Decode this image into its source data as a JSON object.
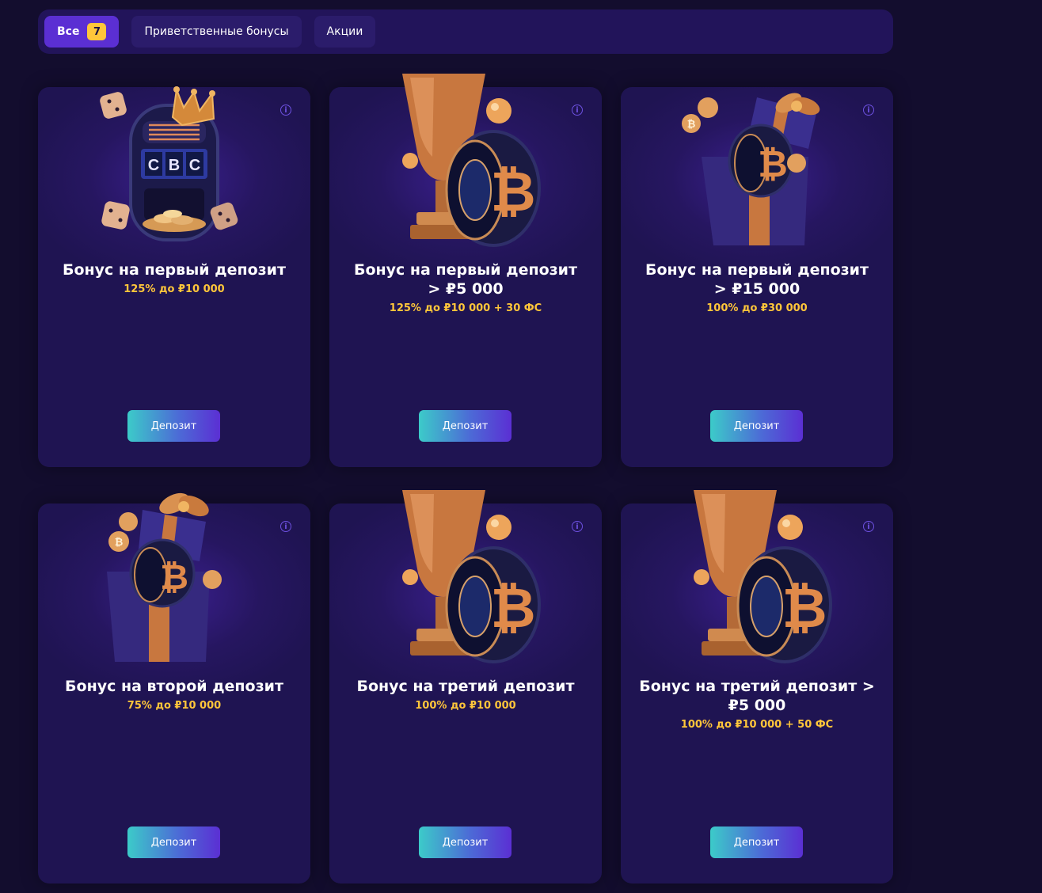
{
  "filters": {
    "all_label": "Все",
    "all_count": "7",
    "welcome_label": "Приветственные бонусы",
    "promo_label": "Акции"
  },
  "cards": [
    {
      "title": "Бонус на первый депозит",
      "subtitle": "125% до ₽10 000",
      "button": "Депозит",
      "art": "slot-machine-icon"
    },
    {
      "title": "Бонус на первый депозит > ₽5 000",
      "subtitle": "125% до ₽10 000 + 30 ФС",
      "button": "Депозит",
      "art": "trophy-bitcoin-icon"
    },
    {
      "title": "Бонус на первый депозит > ₽15 000",
      "subtitle": "100% до ₽30 000",
      "button": "Депозит",
      "art": "gift-box-bitcoin-icon"
    },
    {
      "title": "Бонус на второй депозит",
      "subtitle": "75% до ₽10 000",
      "button": "Депозит",
      "art": "gift-box-bitcoin-icon"
    },
    {
      "title": "Бонус на третий депозит",
      "subtitle": "100% до ₽10 000",
      "button": "Депозит",
      "art": "trophy-bitcoin-icon"
    },
    {
      "title": "Бонус на третий депозит > ₽5 000",
      "subtitle": "100% до ₽10 000 + 50 ФС",
      "button": "Депозит",
      "art": "trophy-bitcoin-icon"
    }
  ],
  "colors": {
    "background": "#130d2e",
    "card": "#1f1452",
    "accent": "#5b2fd3",
    "gold": "#ffc63a",
    "teal": "#3ccbc9"
  }
}
